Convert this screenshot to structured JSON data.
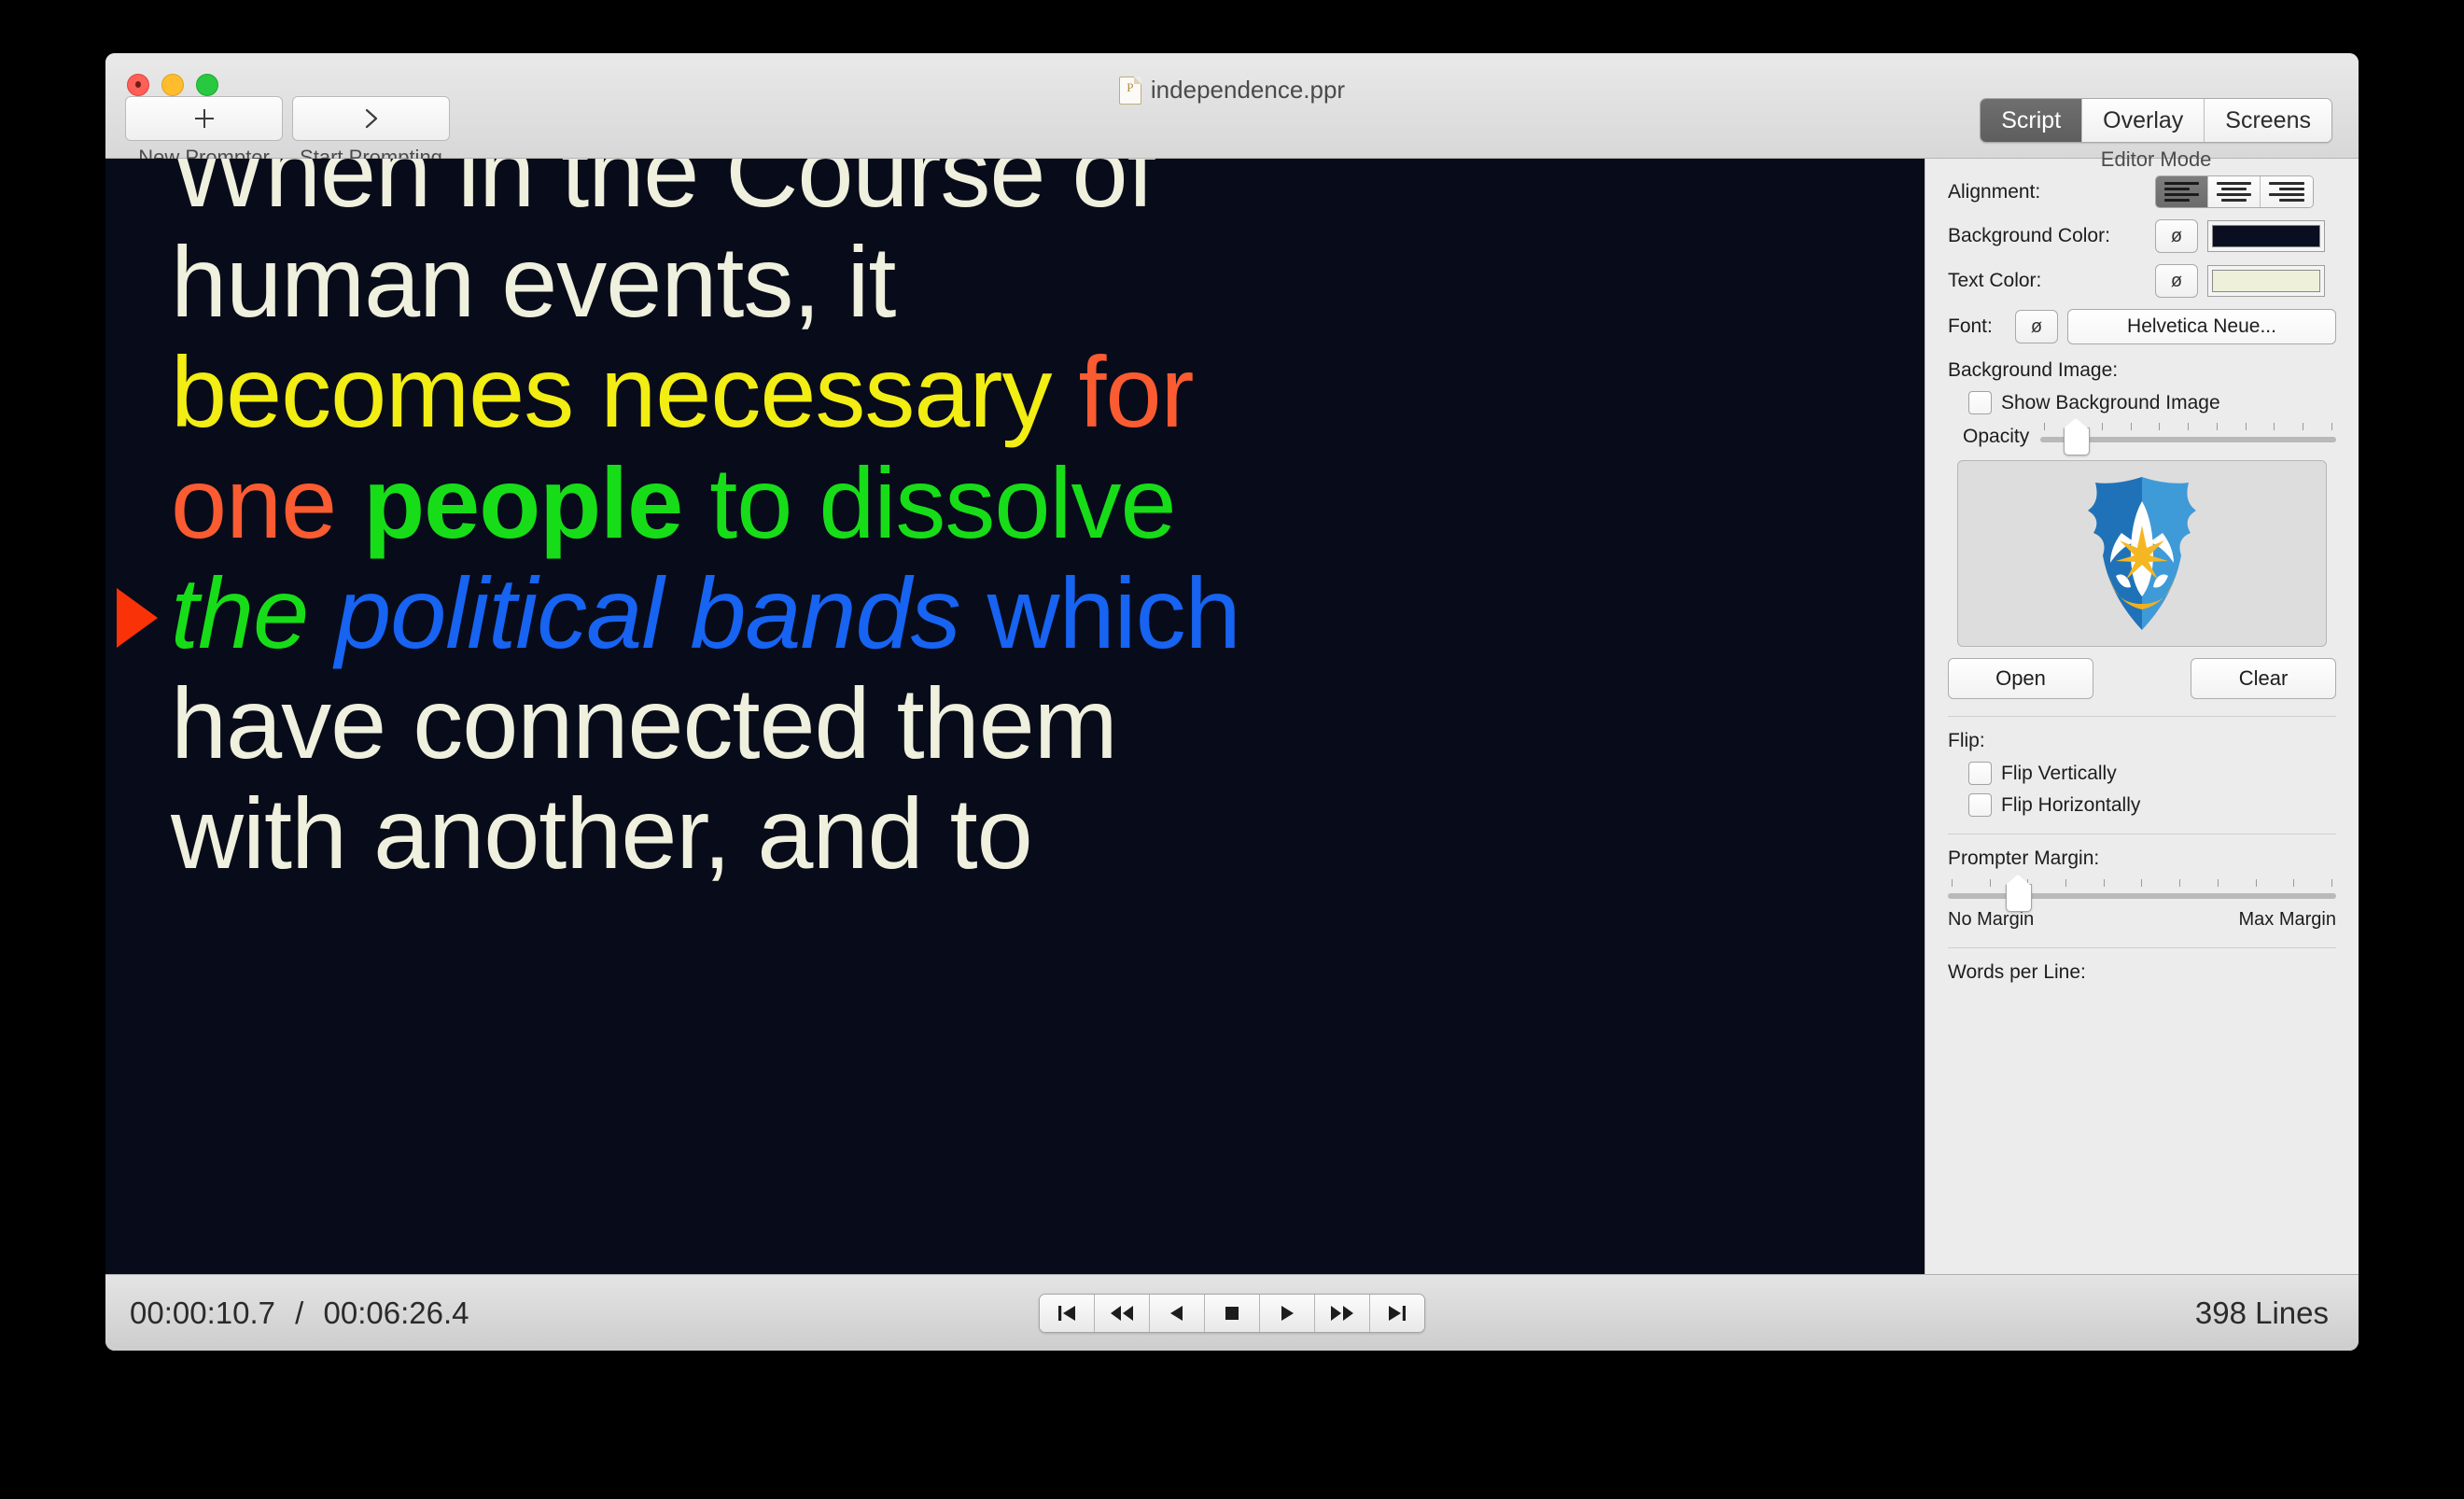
{
  "window": {
    "title": "independence.ppr",
    "title_icon": "document-ppr-icon"
  },
  "toolbar": {
    "new_prompter_label": "New Prompter",
    "new_prompter_icon": "plus-icon",
    "start_prompting_label": "Start Prompting",
    "start_prompting_icon": "chevron-right-icon"
  },
  "editor_mode": {
    "caption": "Editor Mode",
    "tabs": [
      {
        "label": "Script",
        "active": true
      },
      {
        "label": "Overlay",
        "active": false
      },
      {
        "label": "Screens",
        "active": false
      }
    ]
  },
  "prompter": {
    "background_color": "#080c1a",
    "default_text_color": "#eff0dd",
    "marker_icon": "play-marker-triangle-icon",
    "marker_color": "#fa3207",
    "lines": [
      {
        "id": "line-clipped-top",
        "runs": [
          {
            "text": "When in the Course of",
            "color": "#eff0dd",
            "style": "regular"
          }
        ]
      },
      {
        "id": "line-human-events",
        "runs": [
          {
            "text": "human events, it",
            "color": "#eff0dd",
            "style": "regular"
          }
        ]
      },
      {
        "id": "line-becomes-necessary",
        "runs": [
          {
            "text": "becomes necessary ",
            "color": "#f2ed13",
            "style": "regular"
          },
          {
            "text": "for",
            "color": "#fa5b31",
            "style": "regular"
          }
        ]
      },
      {
        "id": "line-one-people",
        "runs": [
          {
            "text": "one ",
            "color": "#fa5b31",
            "style": "regular"
          },
          {
            "text": "people",
            "color": "#17dd19",
            "style": "bold"
          },
          {
            "text": " to dissolve",
            "color": "#17dd19",
            "style": "regular"
          }
        ]
      },
      {
        "id": "line-political-bands",
        "runs": [
          {
            "text": "the ",
            "color": "#17dd19",
            "style": "italic"
          },
          {
            "text": "political bands",
            "color": "#1763f2",
            "style": "italic"
          },
          {
            "text": " which",
            "color": "#1763f2",
            "style": "regular"
          }
        ]
      },
      {
        "id": "line-have-connected",
        "runs": [
          {
            "text": "have connected them",
            "color": "#eff0dd",
            "style": "regular"
          }
        ]
      },
      {
        "id": "line-with-another",
        "runs": [
          {
            "text": "with another, and to",
            "color": "#eff0dd",
            "style": "regular"
          }
        ]
      }
    ]
  },
  "inspector": {
    "alignment": {
      "label": "Alignment:",
      "options": [
        "align-left",
        "align-center",
        "align-right"
      ],
      "selected": "align-left"
    },
    "background_color": {
      "label": "Background Color:",
      "null_button": "ø",
      "value": "#0a0e20"
    },
    "text_color": {
      "label": "Text Color:",
      "null_button": "ø",
      "value": "#eef0d9"
    },
    "font": {
      "label": "Font:",
      "null_button": "ø",
      "value": "Helvetica Neue..."
    },
    "background_image": {
      "label": "Background Image:",
      "show_checkbox_label": "Show Background Image",
      "show_checked": false,
      "opacity_label": "Opacity",
      "opacity_percent": 12,
      "thumbnail_icon": "shield-rocket-emblem",
      "open_button": "Open",
      "clear_button": "Clear"
    },
    "flip": {
      "label": "Flip:",
      "vertical_label": "Flip Vertically",
      "vertical_checked": false,
      "horizontal_label": "Flip Horizontally",
      "horizontal_checked": false
    },
    "prompter_margin": {
      "label": "Prompter Margin:",
      "value_percent": 18,
      "min_label": "No Margin",
      "max_label": "Max Margin"
    },
    "words_per_line": {
      "label": "Words per Line:"
    }
  },
  "statusbar": {
    "current_time": "00:00:10.7",
    "separator": "/",
    "total_time": "00:06:26.4",
    "line_count": "398 Lines",
    "transport": [
      {
        "name": "skip-to-start-button",
        "icon": "skip-back-icon"
      },
      {
        "name": "rewind-button",
        "icon": "rewind-icon"
      },
      {
        "name": "play-reverse-button",
        "icon": "play-reverse-icon"
      },
      {
        "name": "stop-button",
        "icon": "stop-icon"
      },
      {
        "name": "play-button",
        "icon": "play-icon"
      },
      {
        "name": "fast-forward-button",
        "icon": "fast-forward-icon"
      },
      {
        "name": "skip-to-end-button",
        "icon": "skip-forward-icon"
      }
    ]
  }
}
